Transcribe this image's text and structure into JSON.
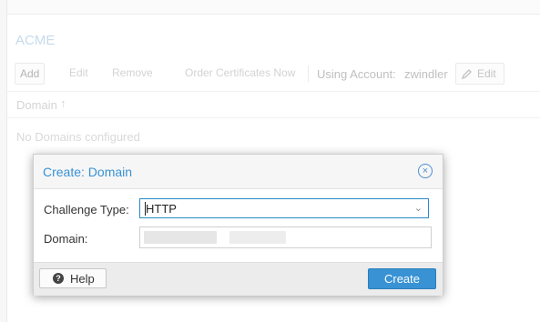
{
  "panel": {
    "title": "ACME",
    "toolbar": {
      "add": "Add",
      "edit": "Edit",
      "remove": "Remove",
      "order": "Order Certificates Now",
      "account_label": "Using Account:",
      "account_value": "zwindler",
      "account_edit": "Edit"
    },
    "grid": {
      "column_domain": "Domain",
      "sort_indicator": "↑",
      "empty_text": "No Domains configured"
    }
  },
  "dialog": {
    "title": "Create: Domain",
    "close_icon": "×",
    "challenge_label": "Challenge Type:",
    "challenge_value": "HTTP",
    "dropdown_icon": "⌄",
    "domain_label": "Domain:",
    "help_icon": "?",
    "help_label": "Help",
    "create_label": "Create"
  },
  "colors": {
    "accent": "#3892d4",
    "select_border": "#2a8bc9"
  }
}
